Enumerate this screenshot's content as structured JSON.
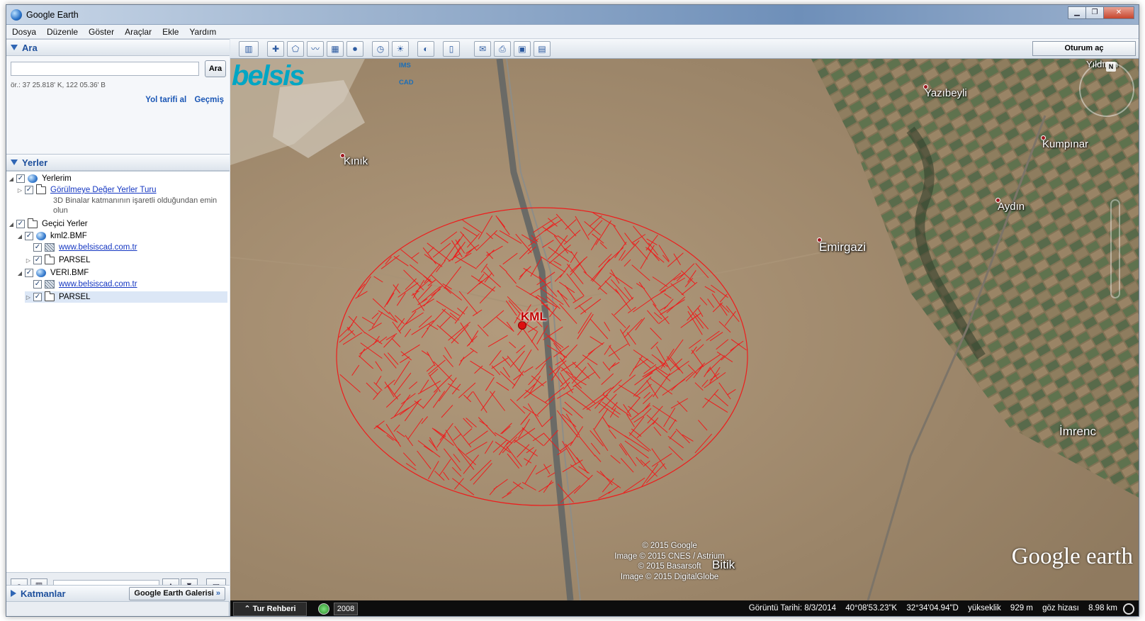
{
  "window": {
    "title": "Google Earth"
  },
  "menu": [
    "Dosya",
    "Düzenle",
    "Göster",
    "Araçlar",
    "Ekle",
    "Yardım"
  ],
  "search": {
    "header": "Ara",
    "placeholder": "",
    "button": "Ara",
    "hint": "ör.: 37 25.818' K, 122 05.36' B",
    "links": [
      "Yol tarifi al",
      "Geçmiş"
    ]
  },
  "places": {
    "header": "Yerler",
    "items": [
      {
        "label": "Yerlerim"
      },
      {
        "label": "Görülmeye Değer Yerler Turu",
        "desc": "3D Binalar katmanının işaretli olduğundan emin olun"
      },
      {
        "label": "Geçici Yerler"
      },
      {
        "label": "kml2.BMF"
      },
      {
        "label": "www.belsiscad.com.tr"
      },
      {
        "label": "PARSEL"
      },
      {
        "label": "VERI.BMF"
      },
      {
        "label": "www.belsiscad.com.tr"
      },
      {
        "label": "PARSEL"
      }
    ]
  },
  "layers": {
    "header": "Katmanlar",
    "gallery_button": "Google Earth Galerisi"
  },
  "toolbar": {
    "login_button": "Oturum aç"
  },
  "map": {
    "logo_text": "belsis",
    "logo_tags": [
      "IMS",
      "CAD"
    ],
    "places": [
      "Kınık",
      "Yazıbeyli",
      "Kumpınar",
      "Aydın",
      "Emirgazi",
      "İmrenc",
      "Bitik",
      "Yıldırım"
    ],
    "marker_label": "KML",
    "copyright": [
      "© 2015 Google",
      "Image © 2015 CNES / Astrium",
      "© 2015 Basarsoft",
      "Image © 2015 DigitalGlobe"
    ],
    "brand": "Google earth",
    "parcel_color": "#ee1c1c"
  },
  "status": {
    "tour_button": "Tur Rehberi",
    "year": "2008",
    "imagery_date": "Görüntü Tarihi: 8/3/2014",
    "lat": "40°08'53.23\"K",
    "lon": "32°34'04.94\"D",
    "elev_label": "yükseklik",
    "elev_value": "929 m",
    "eye_label": "göz hizası",
    "eye_value": "8.98 km"
  }
}
